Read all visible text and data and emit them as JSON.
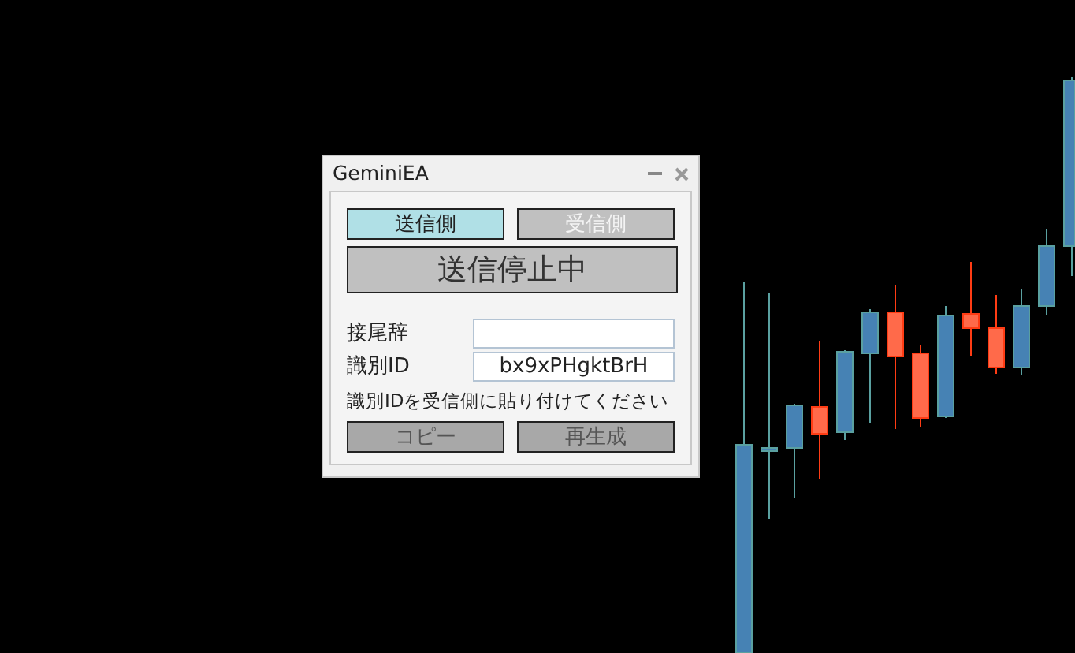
{
  "window": {
    "title": "GeminiEA"
  },
  "modes": [
    {
      "label": "送信側",
      "selected": true
    },
    {
      "label": "受信側",
      "selected": false
    }
  ],
  "status_button": {
    "label": "送信停止中"
  },
  "fields": [
    {
      "label": "接尾辞"
    },
    {
      "label": "識別ID",
      "value": "bx9xPHgktBrH"
    }
  ],
  "hint": "識別IDを受信側に貼り付けてください",
  "buttons": [
    "コピー",
    "再生成"
  ]
}
